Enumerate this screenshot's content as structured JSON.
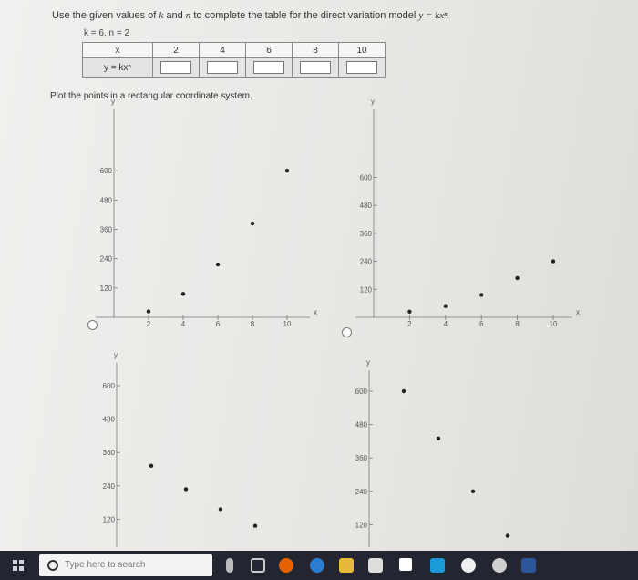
{
  "instruction": "Use the given values of",
  "instruction_k": "k",
  "instruction_and": "and",
  "instruction_n": "n",
  "instruction_rest": "to complete the table for the direct variation model",
  "instruction_model": "y = kxⁿ.",
  "given": "k = 6, n = 2",
  "table": {
    "row1_header": "x",
    "x_values": [
      "2",
      "4",
      "6",
      "8",
      "10"
    ],
    "row2_header": "y = kxⁿ"
  },
  "plot_instruction": "Plot the points in a rectangular coordinate system.",
  "graphs": [
    {
      "y_label": "y",
      "x_label": "x",
      "y_ticks": [
        "600",
        "480",
        "360",
        "240",
        "120"
      ],
      "x_ticks": [
        "2",
        "4",
        "6",
        "8",
        "10"
      ],
      "points": [
        [
          2,
          24
        ],
        [
          4,
          96
        ],
        [
          6,
          216
        ],
        [
          8,
          384
        ],
        [
          10,
          600
        ]
      ]
    },
    {
      "y_label": "y",
      "x_label": "x",
      "y_ticks": [
        "600",
        "480",
        "360",
        "240",
        "120"
      ],
      "x_ticks": [
        "2",
        "4",
        "6",
        "8",
        "10"
      ],
      "points": [
        [
          2,
          24
        ],
        [
          4,
          48
        ],
        [
          6,
          96
        ],
        [
          8,
          168
        ],
        [
          10,
          240
        ]
      ]
    },
    {
      "y_label": "y",
      "y_ticks": [
        "600",
        "480",
        "360",
        "240",
        "120"
      ],
      "points": [
        [
          2,
          312
        ],
        [
          4,
          228
        ],
        [
          6,
          156
        ],
        [
          8,
          96
        ]
      ]
    },
    {
      "y_label": "y",
      "y_ticks": [
        "600",
        "480",
        "360",
        "240",
        "120"
      ],
      "points": [
        [
          2,
          600
        ],
        [
          4,
          430
        ],
        [
          6,
          240
        ],
        [
          8,
          80
        ]
      ]
    }
  ],
  "taskbar": {
    "search_placeholder": "Type here to search",
    "icons": [
      "task-view-icon",
      "firefox-icon",
      "edge-icon",
      "file-explorer-icon",
      "store-icon",
      "dropbox-icon",
      "arrow-icon",
      "vpn-icon",
      "gear-icon",
      "word-icon"
    ]
  }
}
